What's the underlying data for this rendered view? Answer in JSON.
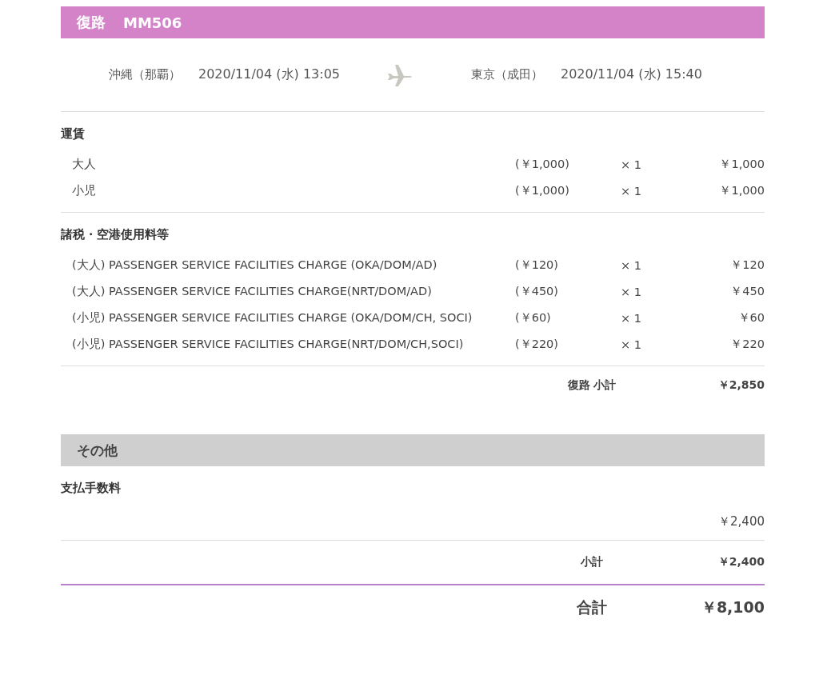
{
  "header": {
    "direction": "復路",
    "flight": "MM506"
  },
  "route": {
    "from": "沖縄（那覇）",
    "departure": "2020/11/04 (水) 13:05",
    "to": "東京（成田）",
    "arrival": "2020/11/04 (水) 15:40"
  },
  "sections": [
    {
      "title": "運賃",
      "rows": [
        {
          "name": "大人",
          "unit_price": "(￥1,000)",
          "quantity": "× 1",
          "amount": "￥1,000"
        },
        {
          "name": "小児",
          "unit_price": "(￥1,000)",
          "quantity": "× 1",
          "amount": "￥1,000"
        }
      ]
    },
    {
      "title": "諸税・空港使用料等",
      "rows": [
        {
          "name": "(大人) PASSENGER SERVICE FACILITIES CHARGE (OKA/DOM/AD)",
          "unit_price": "(￥120)",
          "quantity": "× 1",
          "amount": "￥120"
        },
        {
          "name": "(大人) PASSENGER SERVICE FACILITIES CHARGE(NRT/DOM/AD)",
          "unit_price": "(￥450)",
          "quantity": "× 1",
          "amount": "￥450"
        },
        {
          "name": "(小児) PASSENGER SERVICE FACILITIES CHARGE (OKA/DOM/CH, SOCI)",
          "unit_price": "(￥60)",
          "quantity": "× 1",
          "amount": "￥60"
        },
        {
          "name": "(小児) PASSENGER SERVICE FACILITIES CHARGE(NRT/DOM/CH,SOCI)",
          "unit_price": "(￥220)",
          "quantity": "× 1",
          "amount": "￥220"
        }
      ]
    }
  ],
  "route_subtotal": {
    "label": "復路 小計",
    "amount": "￥2,850"
  },
  "other": {
    "title": "その他",
    "fee_title": "支払手数料",
    "fee_amount": "￥2,400",
    "subtotal_label": "小計",
    "subtotal_amount": "￥2,400"
  },
  "total": {
    "label": "合計",
    "amount": "￥8,100"
  }
}
